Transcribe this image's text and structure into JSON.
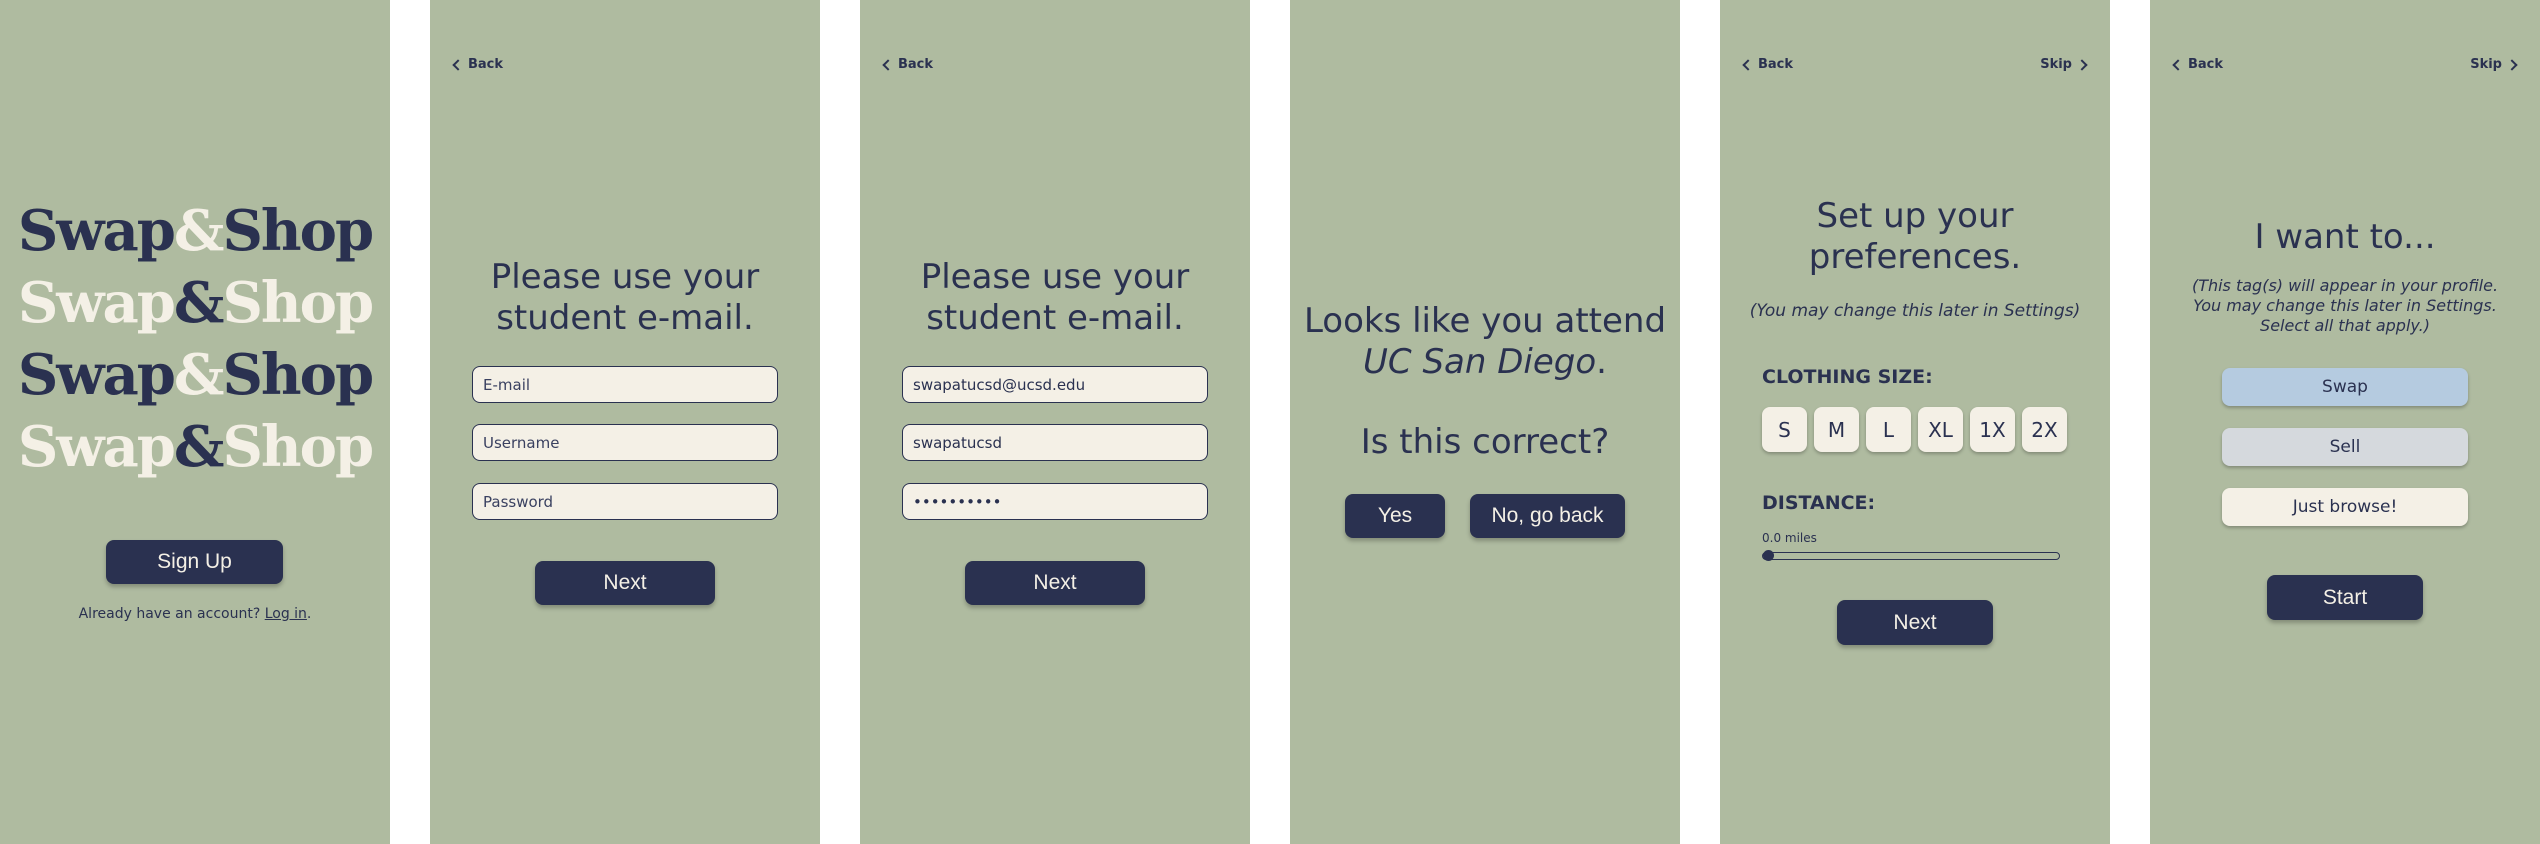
{
  "screen1": {
    "logo": [
      {
        "swap": "Swap",
        "amp": "&",
        "shop": "Shop"
      },
      {
        "swap": "Swap",
        "amp": "&",
        "shop": "Shop"
      },
      {
        "swap": "Swap",
        "amp": "&",
        "shop": "Shop"
      },
      {
        "swap": "Swap",
        "amp": "&",
        "shop": "Shop"
      }
    ],
    "signup_label": "Sign Up",
    "account_prefix": "Already have an account? ",
    "login_link": "Log in",
    "login_suffix": "."
  },
  "screen2": {
    "back_label": "Back",
    "title_line1": "Please use your",
    "title_line2": "student e-mail.",
    "email_placeholder": "E-mail",
    "username_placeholder": "Username",
    "password_placeholder": "Password",
    "next_label": "Next"
  },
  "screen3": {
    "back_label": "Back",
    "title_line1": "Please use your",
    "title_line2": "student e-mail.",
    "email_value": "swapatucsd@ucsd.edu",
    "username_value": "swapatucsd",
    "password_value": "••••••••••",
    "next_label": "Next"
  },
  "screen4": {
    "line1": "Looks like you attend",
    "school": "UC San Diego",
    "period": ".",
    "question": "Is this correct?",
    "yes_label": "Yes",
    "no_label": "No, go back"
  },
  "screen5": {
    "back_label": "Back",
    "skip_label": "Skip",
    "title_line1": "Set up your",
    "title_line2": "preferences.",
    "subtitle": "(You may change this later in Settings)",
    "clothing_label": "CLOTHING SIZE:",
    "sizes": [
      "S",
      "M",
      "L",
      "XL",
      "1X",
      "2X"
    ],
    "distance_label": "DISTANCE:",
    "distance_value": "0.0 miles",
    "distance_fraction": 0,
    "next_label": "Next"
  },
  "screen6": {
    "back_label": "Back",
    "skip_label": "Skip",
    "title": "I want to...",
    "note_line1": "(This tag(s) will appear in your profile.",
    "note_line2": "You may change this later in Settings.",
    "note_line3": "Select all that apply.)",
    "options": [
      "Swap",
      "Sell",
      "Just browse!"
    ],
    "start_label": "Start"
  },
  "colors": {
    "panel_bg": "#afbba0",
    "navy": "#2a3150",
    "cream": "#f4f0e6",
    "swap_blue": "#b5cbe0",
    "sell_gray": "#d5d9dd"
  }
}
